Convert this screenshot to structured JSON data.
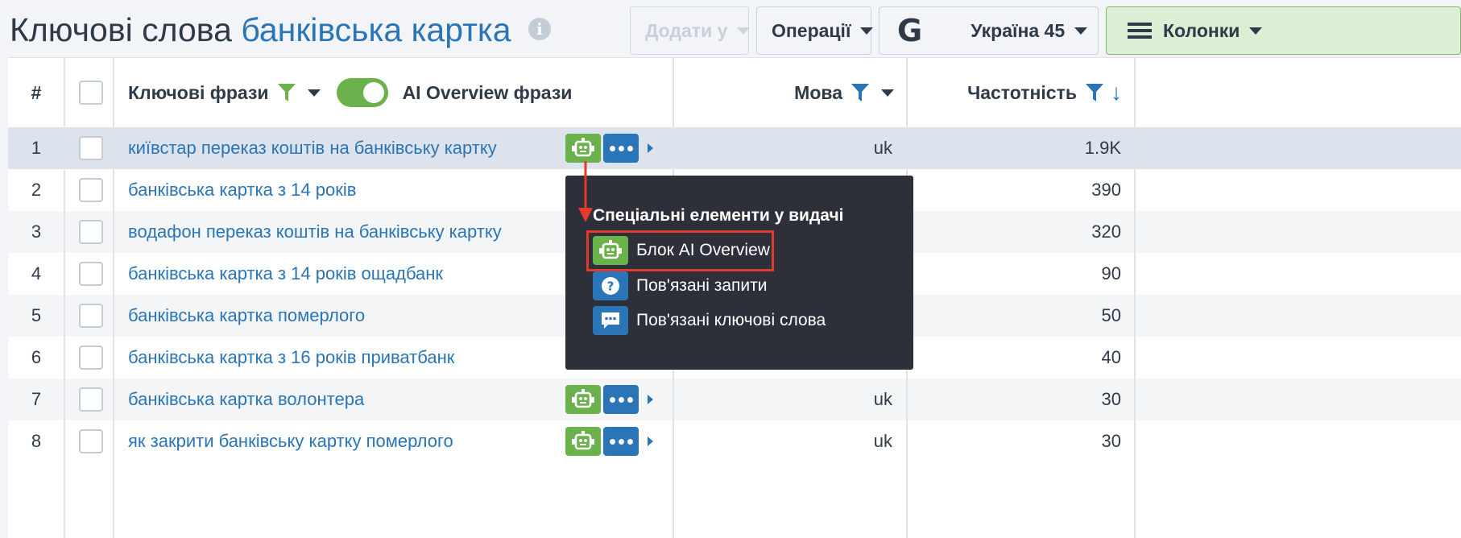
{
  "header": {
    "title_prefix": "Ключові слова",
    "title_keyword": "банківська картка",
    "add_to_label": "Додати у",
    "operations_label": "Операції",
    "search_engine_logo": "G",
    "country_label": "Україна 45",
    "columns_label": "Колонки"
  },
  "table": {
    "columns": {
      "index": "#",
      "keywords": "Ключові фрази",
      "ai_overview": "AI Overview фрази",
      "language": "Мова",
      "frequency": "Частотність"
    },
    "rows": [
      {
        "n": "1",
        "keyword": "київстар переказ коштів на банківську картку",
        "lang": "uk",
        "freq": "1.9K"
      },
      {
        "n": "2",
        "keyword": "банківська картка з 14 років",
        "lang": "",
        "freq": "390"
      },
      {
        "n": "3",
        "keyword": "водафон переказ коштів на банківську картку",
        "lang": "",
        "freq": "320"
      },
      {
        "n": "4",
        "keyword": "банківська картка з 14 років ощадбанк",
        "lang": "",
        "freq": "90"
      },
      {
        "n": "5",
        "keyword": "банківська картка померлого",
        "lang": "",
        "freq": "50"
      },
      {
        "n": "6",
        "keyword": "банківська картка з 16 років приватбанк",
        "lang": "",
        "freq": "40"
      },
      {
        "n": "7",
        "keyword": "банківська картка волонтера",
        "lang": "uk",
        "freq": "30"
      },
      {
        "n": "8",
        "keyword": "як закрити банківську картку померлого",
        "lang": "uk",
        "freq": "30"
      }
    ]
  },
  "popover": {
    "title": "Спеціальні елементи у видачі",
    "items": [
      "Блок AI Overview",
      "Пов'язані запити",
      "Пов'язані ключові слова"
    ]
  },
  "colors": {
    "accent": "#2a74b8",
    "ai_green": "#6bb24d",
    "highlight_red": "#e23b2a",
    "popover_bg": "#2d3038"
  }
}
